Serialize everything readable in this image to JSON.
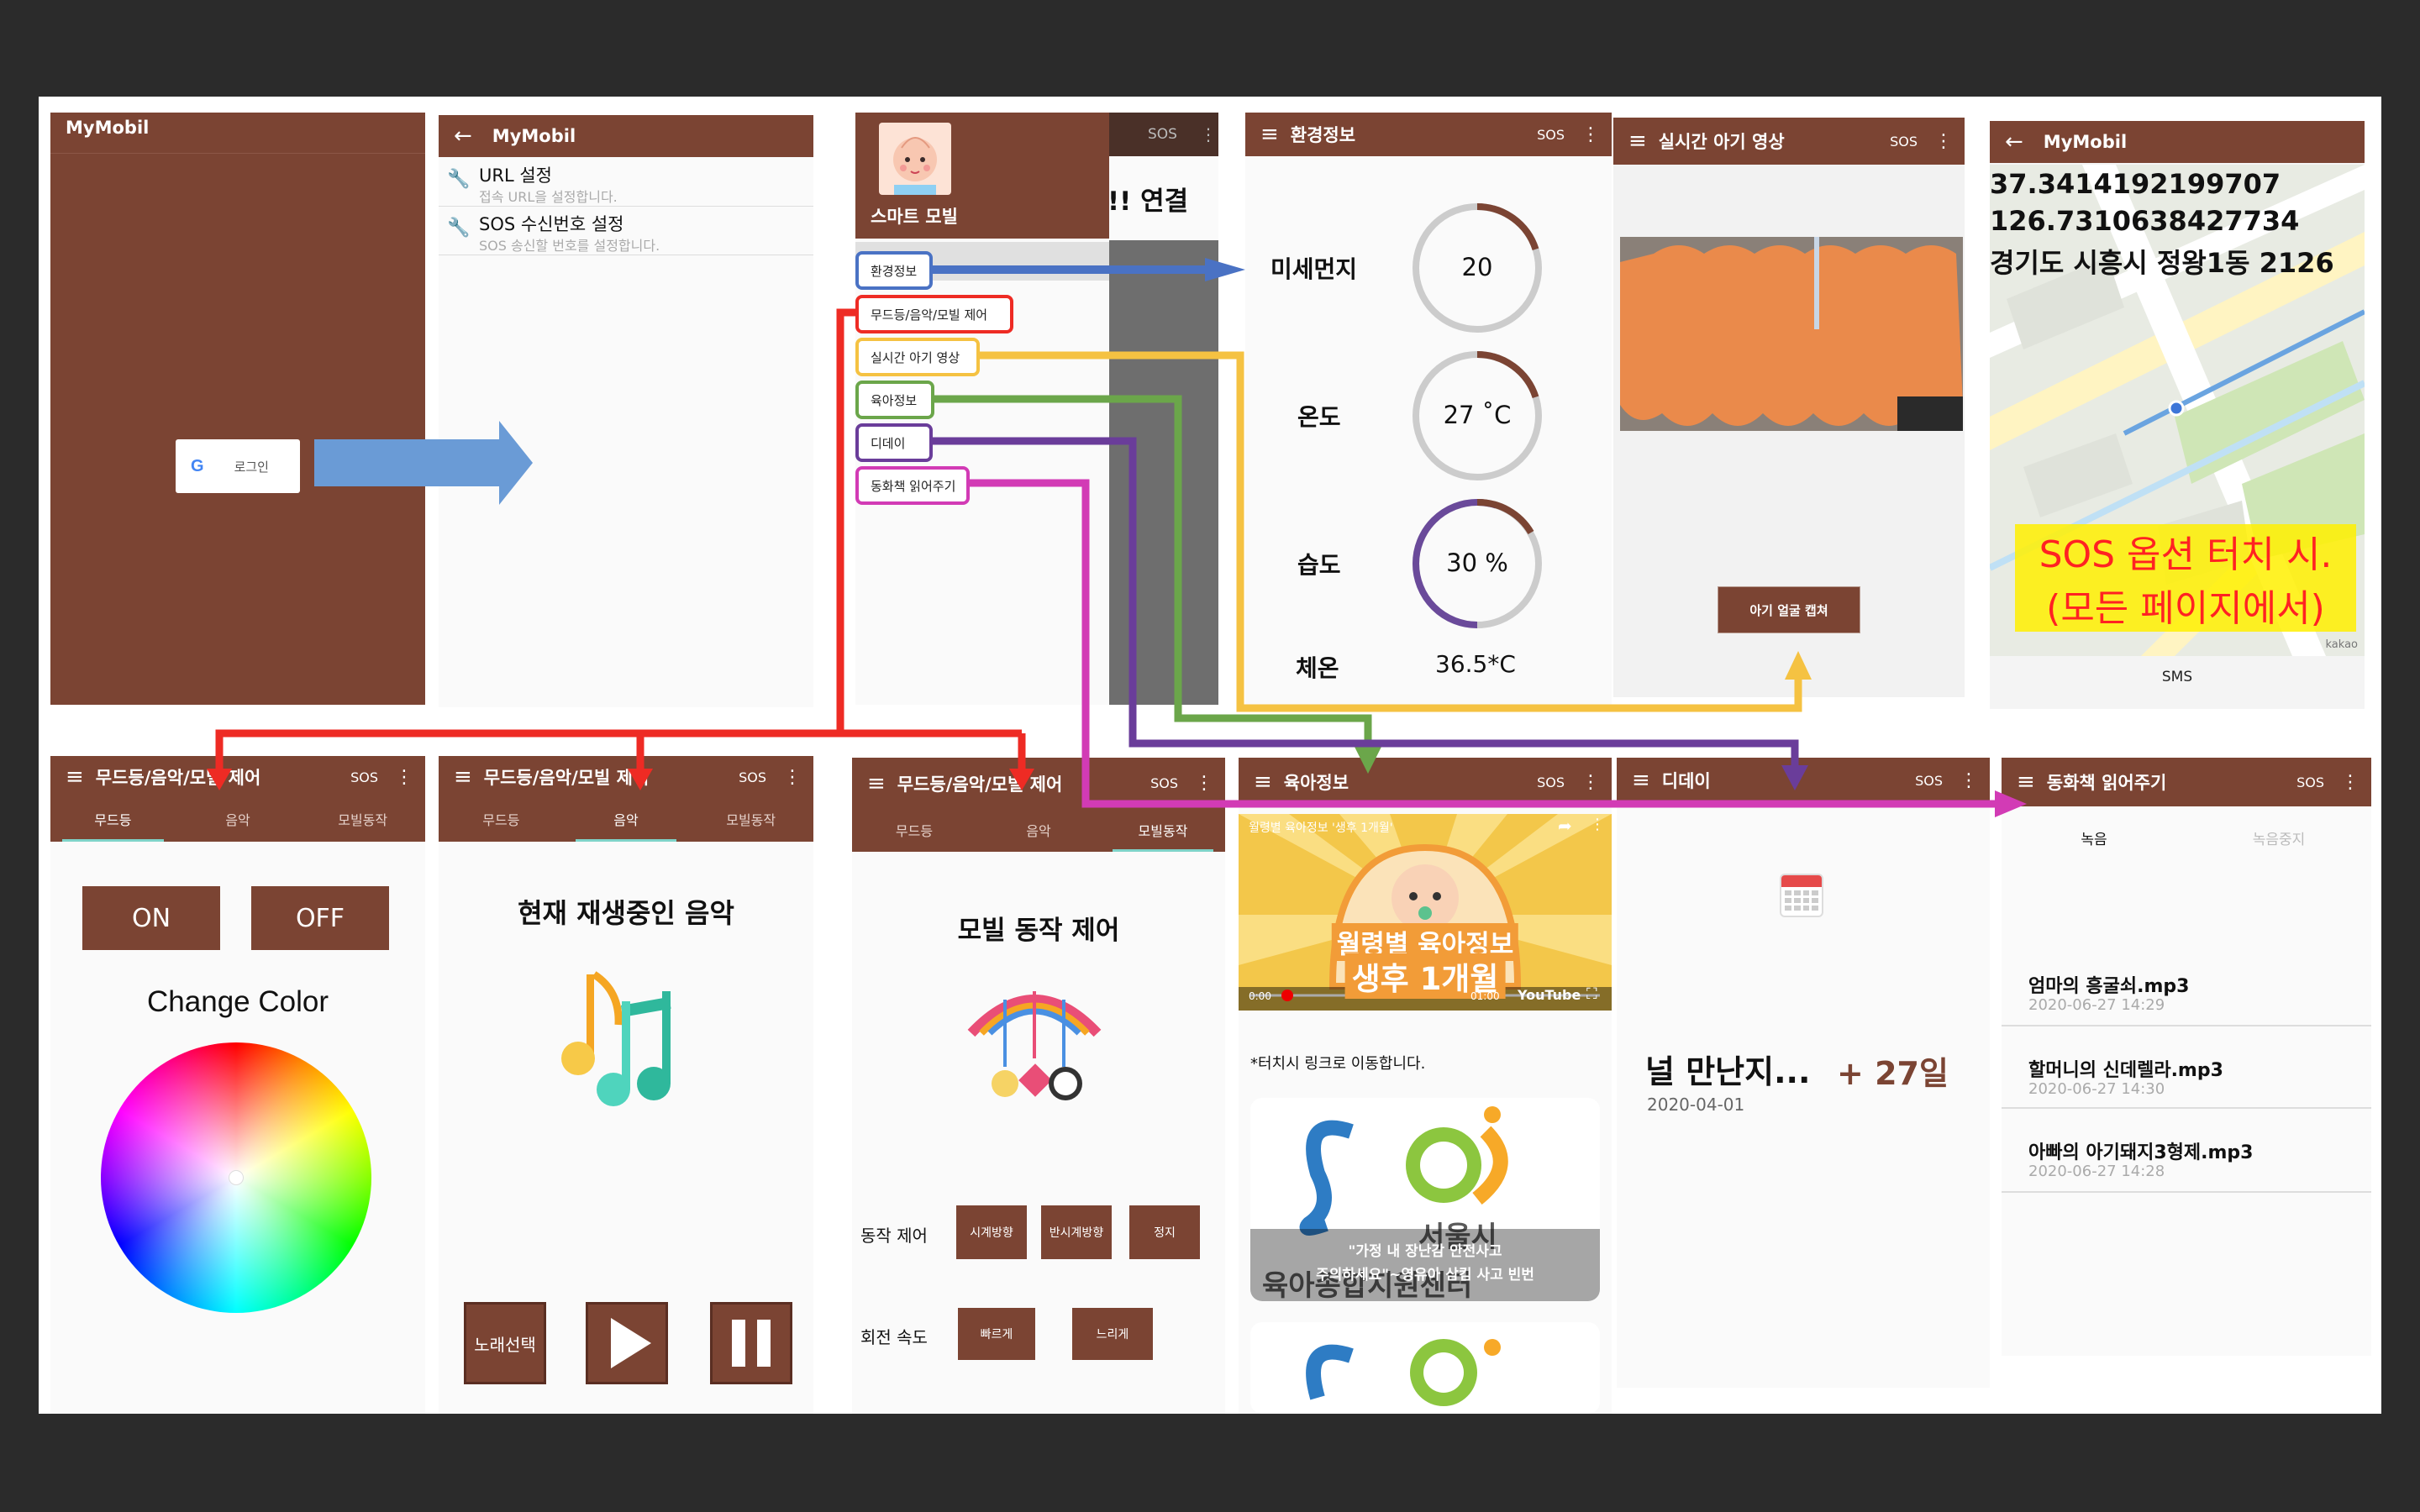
{
  "app_name": "MyMobil",
  "login": {
    "button_label": "로그인"
  },
  "settings": {
    "items": [
      {
        "title": "URL 설정",
        "subtitle": "접속 URL을 설정합니다."
      },
      {
        "title": "SOS 수신번호 설정",
        "subtitle": "SOS 송신할 번호를 설정합니다."
      }
    ]
  },
  "drawer": {
    "header_title": "스마트 모빌",
    "behind_text": "!! 연결",
    "behind_text2": "",
    "behind_sos": "SOS",
    "items": [
      "환경정보",
      "무드등/음악/모빌 제어",
      "실시간 아기 영상",
      "육아정보",
      "디데이",
      "동화책 읽어주기"
    ]
  },
  "environment": {
    "title": "환경정보",
    "sos": "SOS",
    "rows": [
      {
        "label": "미세먼지",
        "value": "20",
        "progress": 0.2
      },
      {
        "label": "온도",
        "value": "27 ˚C",
        "progress": 0.2
      },
      {
        "label": "습도",
        "value": "30 %",
        "progress": 0.55
      }
    ],
    "body_temp_label": "체온",
    "body_temp_value": "36.5*C"
  },
  "live_video": {
    "title": "실시간 아기 영상",
    "sos": "SOS",
    "capture_button": "아기 얼굴 캡쳐"
  },
  "sos_map": {
    "title": "MyMobil",
    "latitude": "37.3414192199707",
    "longitude": "126.7310638427734",
    "address": "경기도 시흥시 정왕1동 2126",
    "overlay_line1": "SOS 옵션 터치 시.",
    "overlay_line2": "(모든 페이지에서)",
    "sms_label": "SMS",
    "map_watermark": "kakao"
  },
  "control": {
    "title": "무드등/음악/모빌 제어",
    "sos": "SOS",
    "tabs": [
      "무드등",
      "음악",
      "모빌동작"
    ]
  },
  "mood": {
    "on": "ON",
    "off": "OFF",
    "change_color": "Change Color"
  },
  "music": {
    "now_playing": "현재 재생중인 음악",
    "select_song": "노래선택"
  },
  "mobile_motion": {
    "heading": "모빌 동작 제어",
    "motion_label": "동작 제어",
    "motion_buttons": [
      "시계방향",
      "반시계방향",
      "정지"
    ],
    "speed_label": "회전 속도",
    "speed_buttons": [
      "빠르게",
      "느리게"
    ]
  },
  "parenting": {
    "title": "육아정보",
    "sos": "SOS",
    "video_caption": "월령별 육아정보 '생후 1개월'",
    "video_title1": "월령별 육아정보",
    "video_title2": "생후 1개월",
    "video_time": "0:00",
    "video_duration": "01:00",
    "youtube": "YouTube",
    "hint": "*터치시 링크로 이동합니다.",
    "card_line1": "\"가정 내 장난감 안전사고",
    "card_line2": "주의하세요\"~영유아 삼킴 사고 빈번",
    "card_bg_text1": "서울시",
    "card_bg_text2": "육아종합지원센터"
  },
  "dday": {
    "title": "디데이",
    "sos": "SOS",
    "label": "널 만난지...",
    "days": "+ 27일",
    "date": "2020-04-01"
  },
  "fairytale": {
    "title": "동화책 읽어주기",
    "sos": "SOS",
    "tabs": [
      "녹음",
      "녹음중지"
    ],
    "files": [
      {
        "name": "엄마의 흥굴쇠.mp3",
        "date": "2020-06-27 14:29"
      },
      {
        "name": "할머니의 신데렐라.mp3",
        "date": "2020-06-27 14:30"
      },
      {
        "name": "아빠의 아기돼지3형제.mp3",
        "date": "2020-06-27 14:28"
      }
    ]
  },
  "colors": {
    "brand": "#7b4433",
    "arrow_blue": "#4a72c4",
    "arrow_red": "#ee2b24",
    "arrow_yellow": "#f5c242",
    "arrow_green": "#6ba64a",
    "arrow_purple": "#6a3d9a",
    "arrow_magenta": "#d23bb5"
  }
}
